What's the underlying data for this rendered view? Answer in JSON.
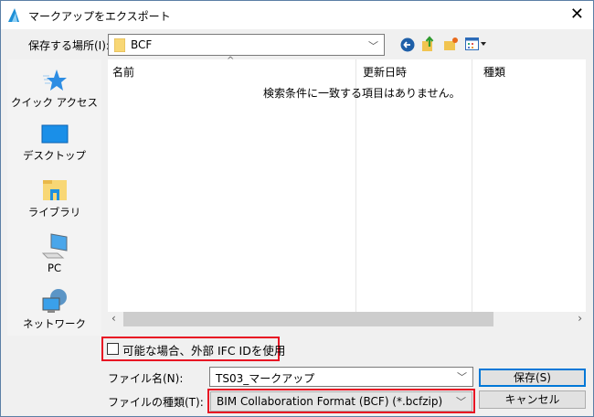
{
  "window": {
    "title": "マークアップをエクスポート"
  },
  "location": {
    "label": "保存する場所(I):",
    "value": "BCF"
  },
  "toolbar": {
    "icons": [
      "back-icon",
      "up-folder-icon",
      "new-folder-icon",
      "view-menu-icon"
    ]
  },
  "sidebar": {
    "items": [
      {
        "label": "クイック アクセス",
        "icon": "star-icon"
      },
      {
        "label": "デスクトップ",
        "icon": "desktop-icon"
      },
      {
        "label": "ライブラリ",
        "icon": "library-icon"
      },
      {
        "label": "PC",
        "icon": "pc-icon"
      },
      {
        "label": "ネットワーク",
        "icon": "network-icon"
      }
    ]
  },
  "file_list": {
    "columns": [
      "名前",
      "更新日時",
      "種類"
    ],
    "empty_message": "検索条件に一致する項目はありません。"
  },
  "option": {
    "label": "可能な場合、外部 IFC IDを使用",
    "checked": false
  },
  "filename": {
    "label": "ファイル名(N):",
    "value": "TS03_マークアップ"
  },
  "filetype": {
    "label": "ファイルの種類(T):",
    "value": "BIM Collaboration Format (BCF) (*.bcfzip)"
  },
  "buttons": {
    "save": "保存(S)",
    "cancel": "キャンセル"
  },
  "colors": {
    "highlight": "#e81123",
    "default_button_border": "#0078d7"
  }
}
